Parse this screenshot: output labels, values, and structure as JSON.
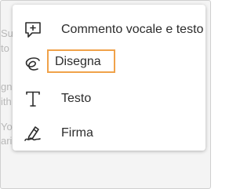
{
  "background_text": [
    {
      "text": "Sub"
    },
    {
      "text": "to c"
    },
    {
      "text": "gn i"
    },
    {
      "text": "ith"
    },
    {
      "text": "You"
    },
    {
      "text": "arin"
    }
  ],
  "menu": {
    "items": [
      {
        "icon": "comment-plus-icon",
        "label": "Commento vocale e testo"
      },
      {
        "icon": "draw-scribble-icon",
        "label": "Disegna",
        "selected": true
      },
      {
        "icon": "text-t-icon",
        "label": "Testo"
      },
      {
        "icon": "signature-pen-icon",
        "label": "Firma"
      }
    ]
  },
  "colors": {
    "highlight_border": "#f0a24a",
    "icon": "#2c2c2c",
    "text": "#2c2c2c",
    "background_text": "#b8b8b8"
  }
}
